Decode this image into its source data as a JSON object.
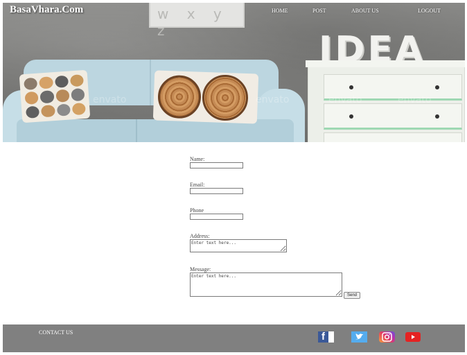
{
  "header": {
    "brand": "BasaVhara.Com",
    "nav": {
      "home": "HOME",
      "post": "POST",
      "about": "ABOUT US",
      "logout": "LOGOUT"
    },
    "hero_decor": {
      "idea_text": "IDEA",
      "frame_text": "w x y z",
      "watermark": "envato"
    }
  },
  "form": {
    "name_label": "Name:",
    "email_label": "Email:",
    "phone_label": "Phone",
    "address_label": "Address:",
    "address_placeholder": "Enter text here...",
    "message_label": "Message:",
    "message_placeholder": "Enter text here...",
    "send_label": "Send"
  },
  "footer": {
    "contact_label": "CONTACT US",
    "social": [
      "facebook",
      "twitter",
      "instagram",
      "youtube"
    ]
  },
  "colors": {
    "footer_bg": "#808080",
    "nav_text": "#ffffff",
    "facebook": "#3b5998",
    "twitter": "#55acee",
    "youtube": "#e52222"
  }
}
